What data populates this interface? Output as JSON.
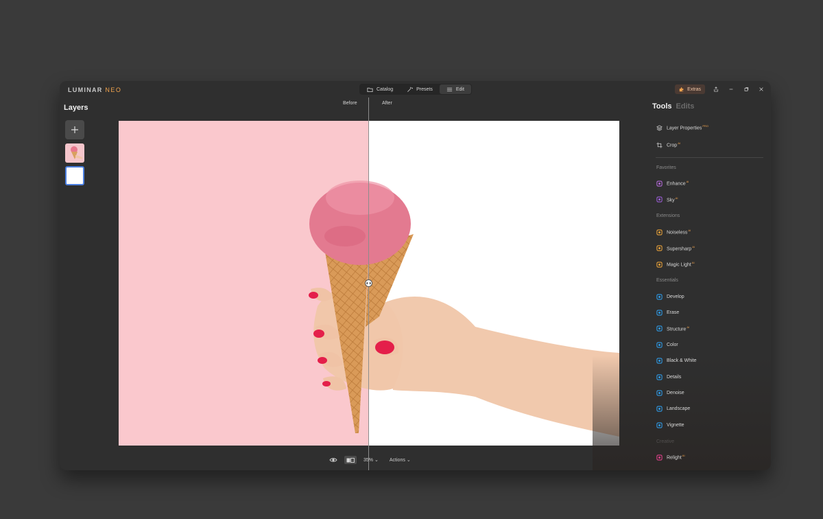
{
  "app": {
    "brand": "LUMINAR",
    "brand_accent": "NEO"
  },
  "modes": [
    {
      "label": "Catalog",
      "icon": "folder-icon",
      "active": false
    },
    {
      "label": "Presets",
      "icon": "presets-icon",
      "active": false
    },
    {
      "label": "Edit",
      "icon": "sliders-icon",
      "active": true
    }
  ],
  "titlebar": {
    "extras_label": "Extras"
  },
  "layers": {
    "title": "Layers"
  },
  "canvas": {
    "before_label": "Before",
    "after_label": "After",
    "split_ratio": 0.5
  },
  "bottombar": {
    "zoom": "35%",
    "zoom_chevron": "⌄",
    "actions_label": "Actions",
    "actions_chevron": "⌄"
  },
  "panel": {
    "tab_tools": "Tools",
    "tab_edits": "Edits"
  },
  "tools": {
    "layer_properties": {
      "label": "Layer Properties",
      "badge": "PRO"
    },
    "crop": {
      "label": "Crop",
      "badge": "AI"
    }
  },
  "sections": {
    "favorites": "Favorites",
    "extensions": "Extensions",
    "essentials": "Essentials",
    "creative": "Creative"
  },
  "favorites": [
    {
      "label": "Enhance",
      "badge": "AI",
      "icon": "enhance-icon",
      "color": "#b46ad8"
    },
    {
      "label": "Sky",
      "badge": "AI",
      "icon": "cloud-icon",
      "color": "#9b5ed6"
    }
  ],
  "extensions": [
    {
      "label": "Noiseless",
      "badge": "AI",
      "icon": "noiseless-icon",
      "color": "#e8a13a"
    },
    {
      "label": "Supersharp",
      "badge": "AI",
      "icon": "supersharp-icon",
      "color": "#e8a13a"
    },
    {
      "label": "Magic Light",
      "badge": "AI",
      "icon": "magic-light-icon",
      "color": "#e8a13a"
    }
  ],
  "essentials": [
    {
      "label": "Develop",
      "badge": "",
      "icon": "sun-icon",
      "color": "#2f9be8"
    },
    {
      "label": "Erase",
      "badge": "",
      "icon": "eraser-icon",
      "color": "#2f9be8"
    },
    {
      "label": "Structure",
      "badge": "AI",
      "icon": "structure-icon",
      "color": "#2f9be8"
    },
    {
      "label": "Color",
      "badge": "",
      "icon": "color-icon",
      "color": "#2f9be8"
    },
    {
      "label": "Black & White",
      "badge": "",
      "icon": "bw-icon",
      "color": "#2f9be8"
    },
    {
      "label": "Details",
      "badge": "",
      "icon": "details-icon",
      "color": "#2f9be8"
    },
    {
      "label": "Denoise",
      "badge": "",
      "icon": "denoise-icon",
      "color": "#2f9be8"
    },
    {
      "label": "Landscape",
      "badge": "",
      "icon": "landscape-icon",
      "color": "#2f9be8"
    },
    {
      "label": "Vignette",
      "badge": "",
      "icon": "vignette-icon",
      "color": "#2f9be8"
    }
  ],
  "creative": [
    {
      "label": "Relight",
      "badge": "AI",
      "icon": "relight-icon",
      "color": "#e0408a"
    }
  ]
}
